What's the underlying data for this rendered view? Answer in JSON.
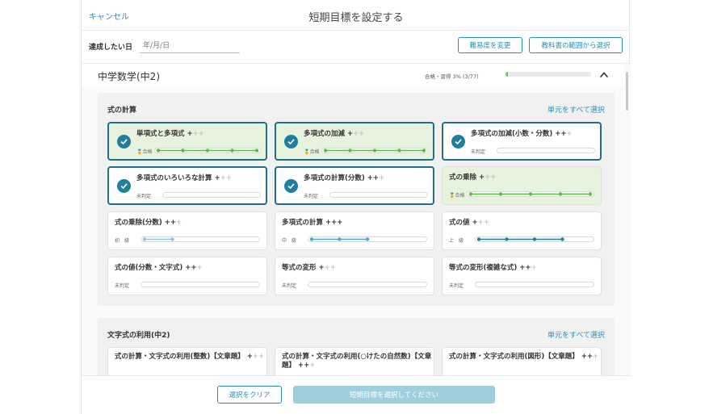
{
  "header": {
    "cancel": "キャンセル",
    "title": "短期目標を設定する"
  },
  "date": {
    "label": "達成したい日",
    "placeholder": "年/月/日"
  },
  "buttons": {
    "change_difficulty": "難易度を変更",
    "select_textbook_range": "教科書の範囲から選択"
  },
  "subject": {
    "name": "中学数学(中2)",
    "pass_rate_text": "合格・習得 3% (3/77)",
    "pass_rate_fraction": 0.03
  },
  "sections": [
    {
      "title": "式の計算",
      "select_all": "単元をすべて選択",
      "cards": [
        {
          "name": "単項式と多項式",
          "lv_on": "+",
          "lv_off": "++",
          "status": "合格",
          "selected": true,
          "passed": true,
          "progress": 1.0,
          "dots": 5
        },
        {
          "name": "多項式の加減",
          "lv_on": "+",
          "lv_off": "++",
          "status": "合格",
          "selected": true,
          "passed": true,
          "progress": 1.0,
          "dots": 5
        },
        {
          "name": "多項式の加減(小数・分数)",
          "lv_on": "++",
          "lv_off": "+",
          "status": "未判定",
          "selected": true,
          "passed": false,
          "progress": 0,
          "dots": 0
        },
        {
          "name": "多項式のいろいろな計算",
          "lv_on": "+",
          "lv_off": "++",
          "status": "未判定",
          "selected": true,
          "passed": false,
          "progress": 0,
          "dots": 0
        },
        {
          "name": "多項式の計算(分数)",
          "lv_on": "++",
          "lv_off": "+",
          "status": "未判定",
          "selected": true,
          "passed": false,
          "progress": 0,
          "dots": 0
        },
        {
          "name": "式の乗除",
          "lv_on": "+",
          "lv_off": "++",
          "status": "合格",
          "selected": false,
          "passed": true,
          "progress": 1.0,
          "dots": 5
        },
        {
          "name": "式の乗除(分数)",
          "lv_on": "++",
          "lv_off": "+",
          "status": "初　級",
          "selected": false,
          "passed": false,
          "progress": 0.25,
          "dots": 2
        },
        {
          "name": "多項式の計算",
          "lv_on": "+++",
          "lv_off": "",
          "status": "中　級",
          "selected": false,
          "passed": false,
          "progress": 0.5,
          "dots": 3
        },
        {
          "name": "式の値",
          "lv_on": "+",
          "lv_off": "++",
          "status": "上　級",
          "selected": false,
          "passed": false,
          "progress": 0.75,
          "dots": 4
        },
        {
          "name": "式の値(分数・文字式)",
          "lv_on": "++",
          "lv_off": "+",
          "status": "未判定",
          "selected": false,
          "passed": false,
          "progress": 0,
          "dots": 0
        },
        {
          "name": "等式の変形",
          "lv_on": "+",
          "lv_off": "++",
          "status": "未判定",
          "selected": false,
          "passed": false,
          "progress": 0,
          "dots": 0
        },
        {
          "name": "等式の変形(複雑な式)",
          "lv_on": "++",
          "lv_off": "+",
          "status": "未判定",
          "selected": false,
          "passed": false,
          "progress": 0,
          "dots": 0
        }
      ]
    },
    {
      "title": "文字式の利用(中2)",
      "select_all": "単元をすべて選択",
      "cards": [
        {
          "name": "式の計算・文字式の利用(整数)【文章題】",
          "lv_on": "+",
          "lv_off": "++"
        },
        {
          "name": "式の計算・文字式の利用(○けたの自然数)【文章題】",
          "lv_on": "++",
          "lv_off": "+"
        },
        {
          "name": "式の計算・文字式の利用(図形)【文章題】",
          "lv_on": "++",
          "lv_off": "+"
        }
      ]
    }
  ],
  "footer": {
    "clear": "選択をクリア",
    "submit": "短期目標を選択してください"
  },
  "colors": {
    "accent": "#2a8fb5",
    "selected_border": "#1f6f86",
    "passed_bg": "#e7f3de",
    "passed_bar": "#5cb848",
    "level_beginner": "#8cc6dc",
    "level_intermediate": "#4aa8c8",
    "level_advanced": "#1f7f9c"
  },
  "icons": {
    "check": "check-icon",
    "chevron": "chevron-up-icon",
    "medal": "medal-icon"
  }
}
